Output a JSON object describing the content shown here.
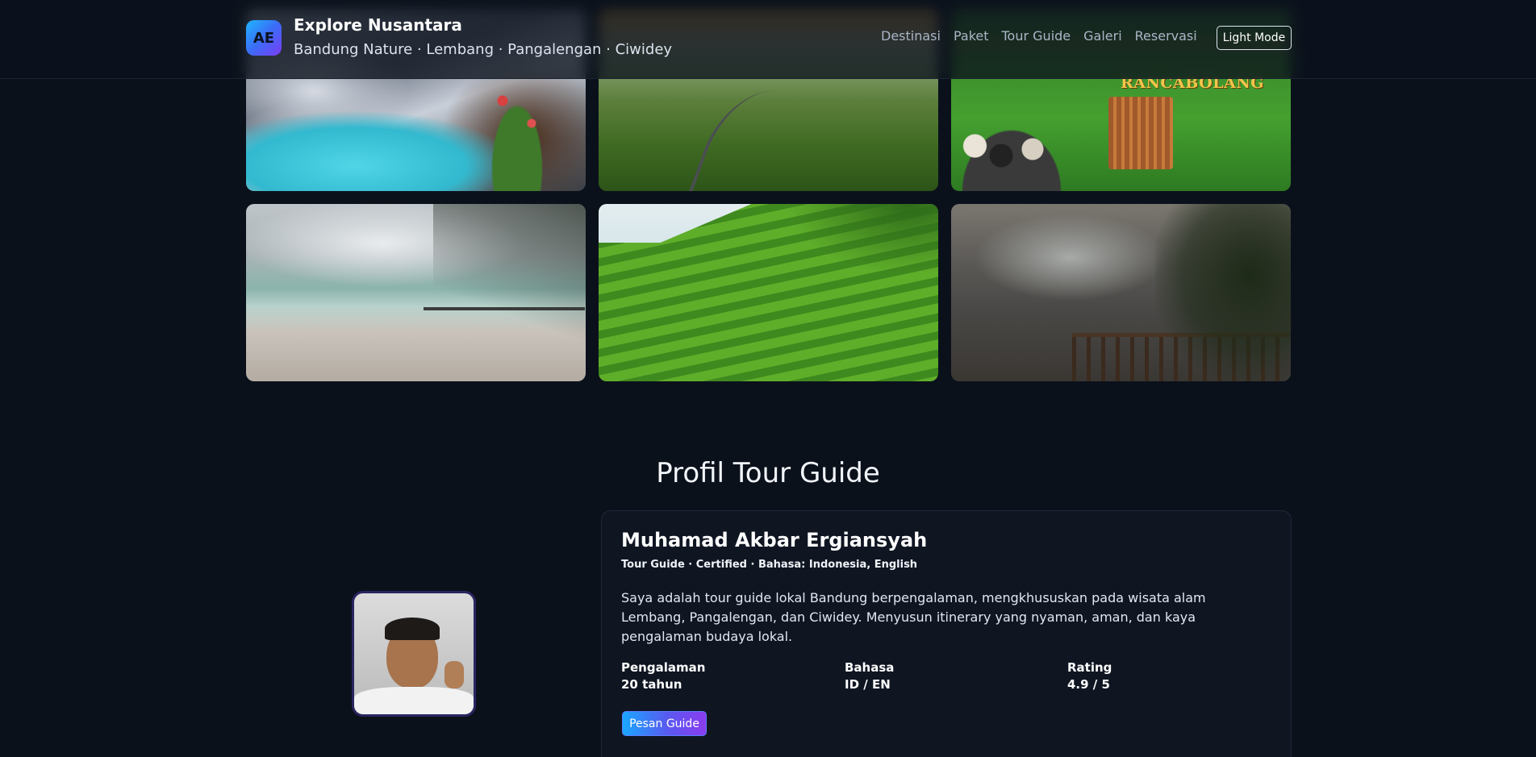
{
  "brand": {
    "logo_text": "AE",
    "title": "Explore Nusantara",
    "subtitle": "Bandung Nature · Lembang · Pangalengan · Ciwidey"
  },
  "nav": {
    "items": [
      "Destinasi",
      "Paket",
      "Tour Guide",
      "Galeri",
      "Reservasi"
    ],
    "mode_toggle": "Light Mode"
  },
  "gallery": {
    "sign_text": "RANCABOLANG"
  },
  "profile": {
    "section_title": "Profil Tour Guide",
    "name": "Muhamad Akbar Ergiansyah",
    "meta": "Tour Guide · Certified · Bahasa: Indonesia, English",
    "bio": "Saya adalah tour guide lokal Bandung berpengalaman, mengkhususkan pada wisata alam Lembang, Pangalengan, dan Ciwidey. Menyusun itinerary yang nyaman, aman, dan kaya pengalaman budaya lokal.",
    "stats": [
      {
        "label": "Pengalaman",
        "value": "20 tahun"
      },
      {
        "label": "Bahasa",
        "value": "ID / EN"
      },
      {
        "label": "Rating",
        "value": "4.9 / 5"
      }
    ],
    "book_button": "Pesan Guide"
  },
  "colors": {
    "background": "#0b111b",
    "accent_start": "#1aa7ff",
    "accent_end": "#8a3cf0",
    "sign_yellow": "#f1c64a"
  }
}
